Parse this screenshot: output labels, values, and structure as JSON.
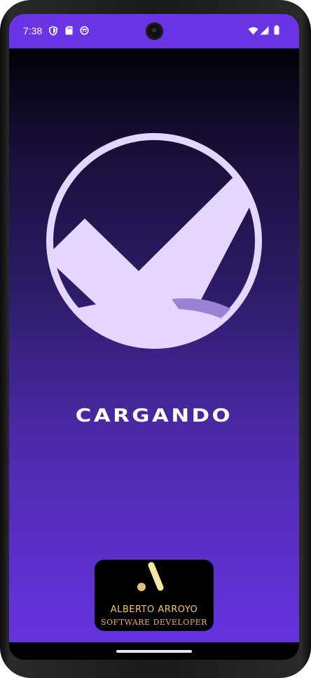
{
  "status_bar": {
    "time": "7:38",
    "left_icons": [
      "shield-icon",
      "sd-card-icon",
      "face-icon"
    ],
    "right_icons": [
      "wifi-icon",
      "signal-icon",
      "battery-icon"
    ],
    "background_color": "#6a34e6"
  },
  "splash": {
    "loading_text": "CARGANDO",
    "logo_icon": "check-circle-logo-icon",
    "logo_color": "#e4d6ff"
  },
  "developer_badge": {
    "name": "ALBERTO ARROYO",
    "role": "SOFTWARE DEVELOPER",
    "mark_icon": "developer-logo-icon",
    "accent_color": "#f1c766"
  },
  "gradient": {
    "top": "#020106",
    "bottom": "#6633e0"
  }
}
